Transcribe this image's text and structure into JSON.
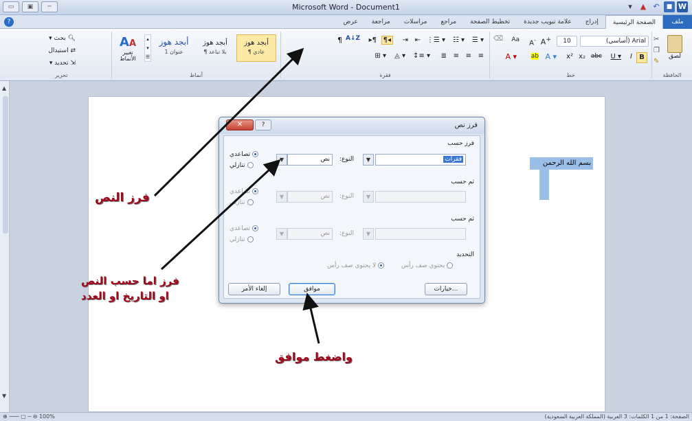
{
  "window": {
    "title": "Microsoft Word - Document1",
    "controls": [
      "▭",
      "▣",
      "─"
    ]
  },
  "tabs": [
    "ملف",
    "الصفحة الرئيسية",
    "إدراج",
    "علامة تبويب جديدة",
    "تخطيط الصفحة",
    "مراجع",
    "مراسلات",
    "مراجعة",
    "عرض"
  ],
  "ribbon": {
    "clipboard_label": "الحافظة",
    "paste_label": "لصق",
    "font_label": "خط",
    "font_name": "Arial (أساسي)",
    "font_size": "10",
    "paragraph_label": "فقرة",
    "styles_label": "أنماط",
    "editing_label": "تحرير",
    "styles": [
      {
        "top": "أبجد هوز",
        "bottom": "¶ عادي"
      },
      {
        "top": "أبجد هوز",
        "bottom": "¶ بلا تباعد"
      },
      {
        "top": "أبجد هوز",
        "bottom": "عنوان 1"
      }
    ],
    "change_styles": "تغيير الأنماط",
    "find": "بحث",
    "replace": "استبدال",
    "select": "تحديد",
    "sort_icon_text": "A↓Z"
  },
  "document": {
    "text": "بسم الله الرحمن"
  },
  "dialog": {
    "title": "فرز نص",
    "close": "✕",
    "help": "?",
    "sort_by": "فرز حسب",
    "then_by_1": "ثم حسب",
    "then_by_2": "ثم حسب",
    "field_1": "فقرات",
    "type_label": "النوع:",
    "type_value": "نص",
    "ascending": "تصاعدي",
    "descending": "تنازلي",
    "header_section": "التحديد",
    "has_header": "يحتوي صف رأس",
    "no_header": "لا يحتوي صف رأس",
    "options": "خيارات...",
    "ok": "موافق",
    "cancel": "إلغاء الأمر"
  },
  "annotations": {
    "sort_text": "فرز النص",
    "sort_by_line1": "فرز اما حسب النص",
    "sort_by_line2": "او التاريخ او العدد",
    "press_ok": "واضغط موافق"
  },
  "statusbar": {
    "left": "⊕ ─── ▢ ─ ⊖ 100%",
    "right": "الصفحة: 1 من 1   الكلمات: 3   العربية (المملكة العربية السعودية)"
  }
}
